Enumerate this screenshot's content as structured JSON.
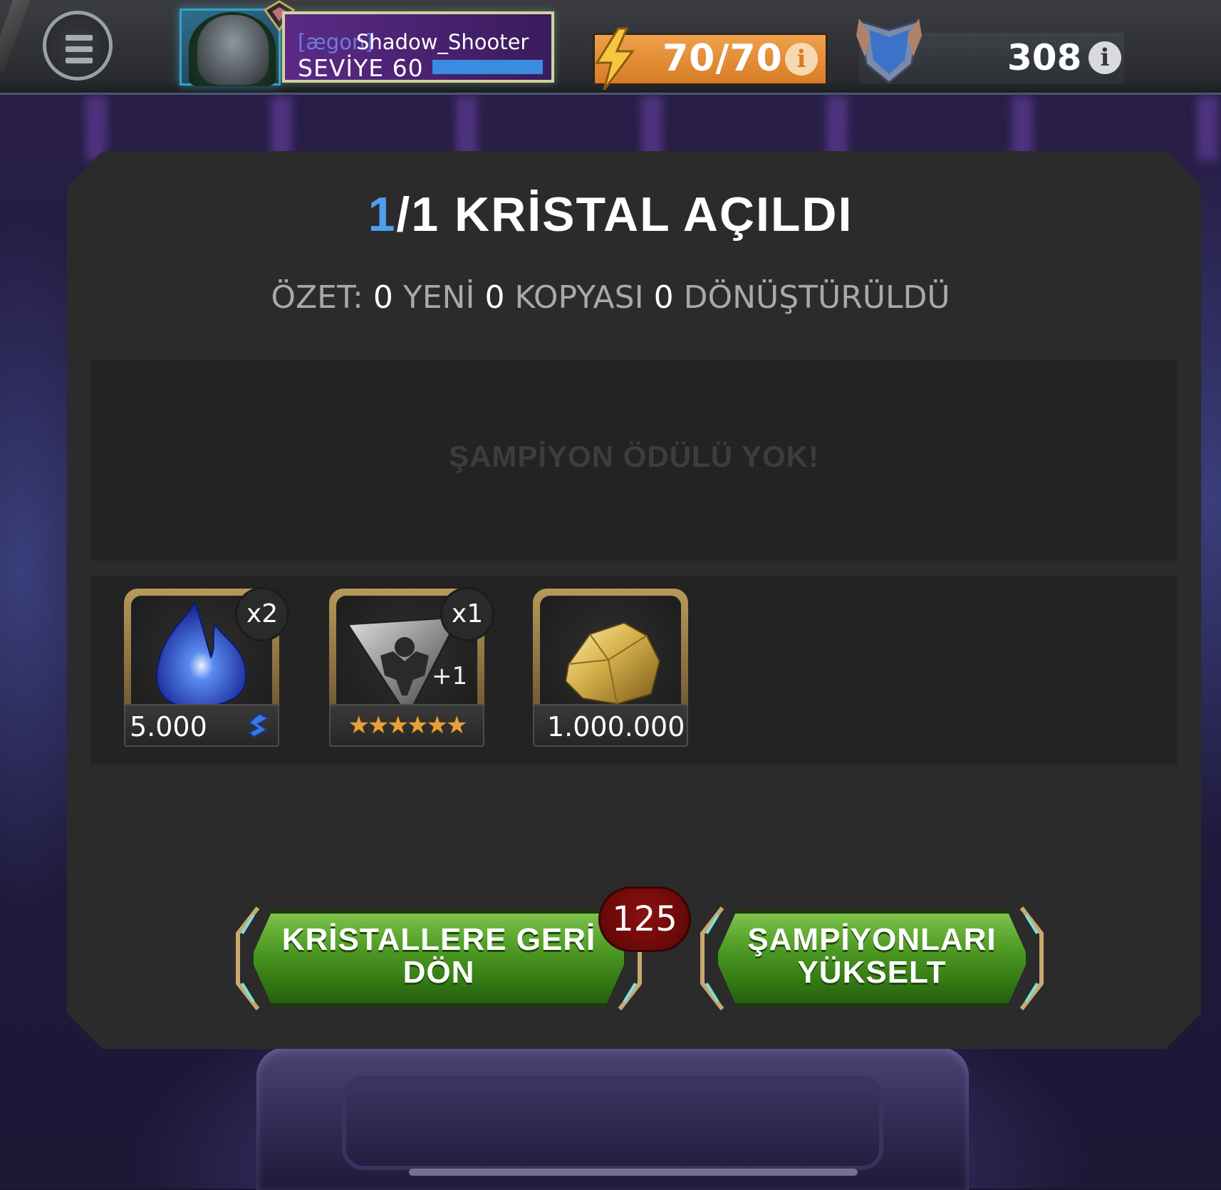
{
  "topbar": {
    "player": {
      "alliance_tag": "[ægon]",
      "name": "Shadow_Shooter",
      "level_label": "SEVİYE 60",
      "xp_fraction": 1.0
    },
    "energy": {
      "value": "70/70",
      "icon": "lightning-icon",
      "info_icon": "info-icon"
    },
    "units": {
      "value": "308",
      "icon": "shield-icon",
      "info_icon": "info-icon"
    },
    "menu_icon": "hamburger-menu-icon"
  },
  "panel": {
    "title_count": "1",
    "title_rest": "/1 KRİSTAL AÇILDI",
    "summary": {
      "prefix": "ÖZET:",
      "new_count": "0",
      "new_label": "YENİ",
      "dupe_count": "0",
      "dupe_label": "KOPYASI",
      "converted_count": "0",
      "converted_label": "DÖNÜŞTÜRÜLDÜ"
    },
    "no_champion_text": "ŞAMPİYON ÖDÜLÜ YOK!",
    "rewards": [
      {
        "icon": "blue-shard-icon",
        "quantity": "x2",
        "value": "5.000",
        "sub_icon": "shard-icon"
      },
      {
        "icon": "class-catalyst-icon",
        "quantity": "x1",
        "overlay": "+1",
        "stars": "★★★★★★"
      },
      {
        "icon": "gold-nugget-icon",
        "value": "1.000.000"
      }
    ],
    "buttons": {
      "back": {
        "label": "KRİSTALLERE GERİ DÖN",
        "badge": "125"
      },
      "upgrade": {
        "label": "ŞAMPİYONLARI YÜKSELT"
      }
    }
  },
  "colors": {
    "title_accent": "#4e9ff0",
    "button_green": "#4e9a24",
    "energy_orange": "#e08a34",
    "badge_red": "#7a0c0c",
    "name_panel_purple": "#5b2a86"
  }
}
